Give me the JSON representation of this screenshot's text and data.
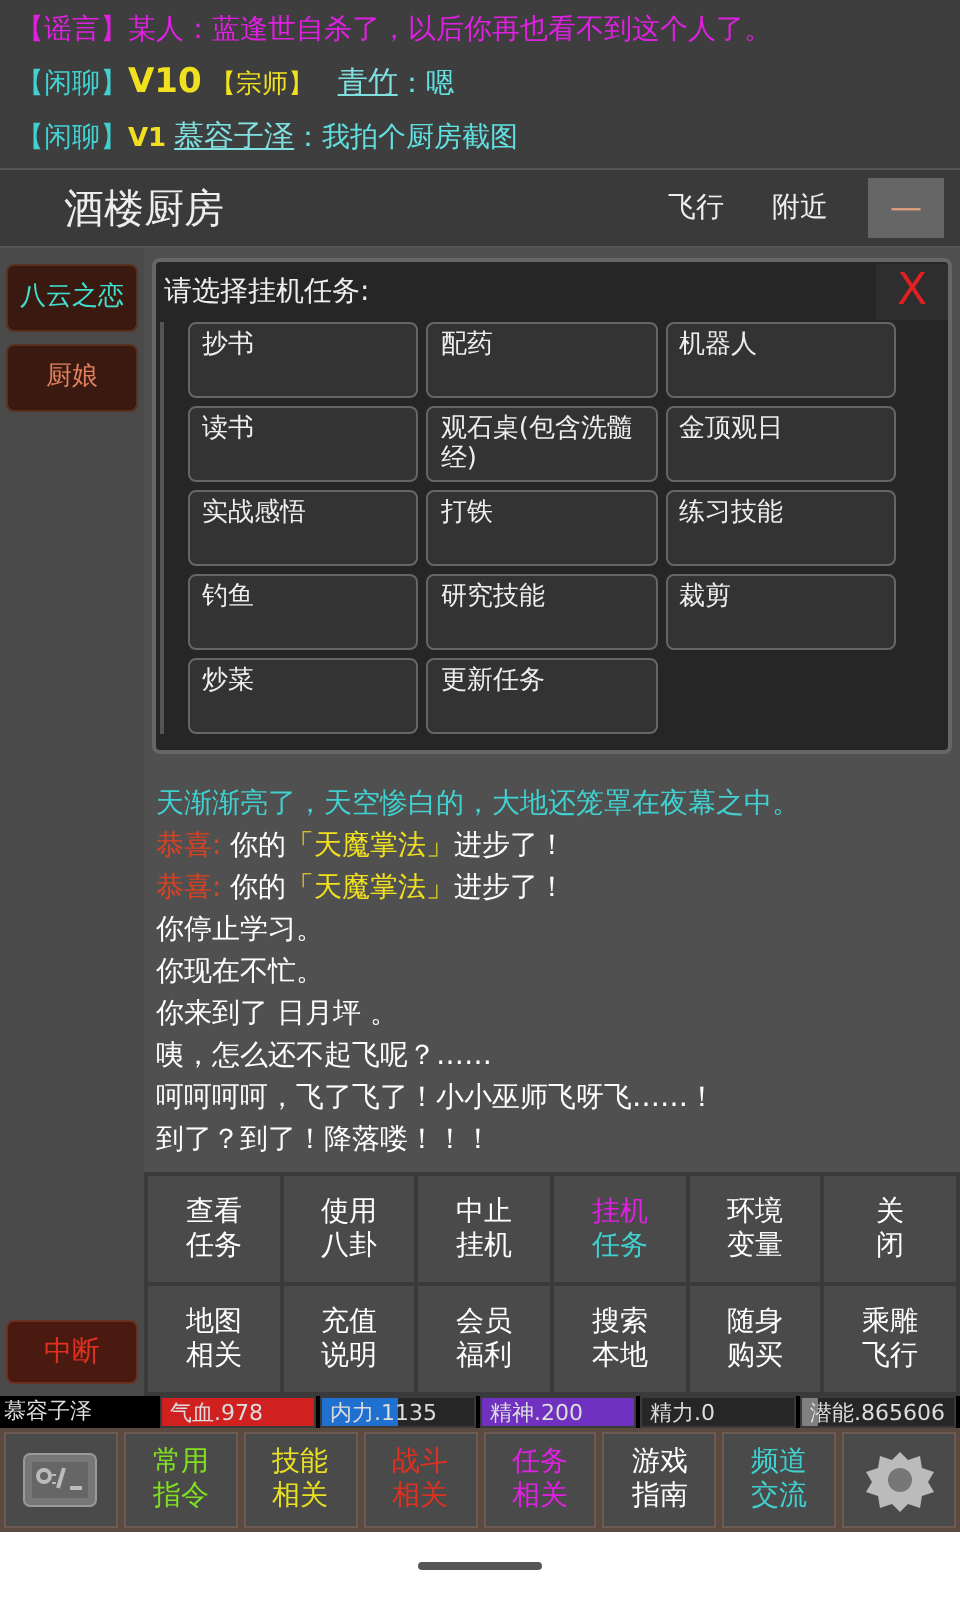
{
  "chat": [
    {
      "kind": "rumor",
      "channel": "【谣言】",
      "name": "某人",
      "name_link": false,
      "text": "：蓝逢世自杀了，以后你再也看不到这个人了。"
    },
    {
      "kind": "chat",
      "channel": "【闲聊】",
      "level_tag": "V10",
      "rank": "【宗师】",
      "name": "青竹",
      "name_link": true,
      "text": "：嗯"
    },
    {
      "kind": "chat",
      "channel": "【闲聊】",
      "level_tag": "V1",
      "name": "慕容子泽",
      "name_link": true,
      "text": "：我拍个厨房截图"
    }
  ],
  "location": {
    "title": "酒楼厨房",
    "actions": [
      "飞行",
      "附近"
    ],
    "menu": "—"
  },
  "side_buttons": [
    {
      "label": "八云之恋",
      "color": "#40e0d0"
    },
    {
      "label": "厨娘",
      "color": "#e08060"
    }
  ],
  "dialog": {
    "title": "请选择挂机任务:",
    "close": "X",
    "options": [
      "抄书",
      "配药",
      "机器人",
      "读书",
      "观石桌(包含洗髓经)",
      "金顶观日",
      "实战感悟",
      "打铁",
      "练习技能",
      "钓鱼",
      "研究技能",
      "裁剪",
      "炒菜",
      "更新任务"
    ]
  },
  "log": [
    {
      "parts": [
        {
          "text": "天渐渐亮了，天空惨白的，大地还笼罩在夜幕之中。",
          "color": "#40d0d0"
        }
      ]
    },
    {
      "parts": [
        {
          "text": "恭喜:",
          "color": "#e04020"
        },
        {
          "text": " 你的",
          "color": "#ffffff"
        },
        {
          "text": "「天魔掌法」",
          "color": "#f0e020"
        },
        {
          "text": "进步了！",
          "color": "#ffffff"
        }
      ]
    },
    {
      "parts": [
        {
          "text": "恭喜:",
          "color": "#e04020"
        },
        {
          "text": " 你的",
          "color": "#ffffff"
        },
        {
          "text": "「天魔掌法」",
          "color": "#f0e020"
        },
        {
          "text": "进步了！",
          "color": "#ffffff"
        }
      ]
    },
    {
      "parts": [
        {
          "text": "你停止学习。",
          "color": "#ffffff"
        }
      ]
    },
    {
      "parts": [
        {
          "text": "你现在不忙。",
          "color": "#ffffff"
        }
      ]
    },
    {
      "parts": [
        {
          "text": "你来到了 日月坪 。",
          "color": "#ffffff"
        }
      ]
    },
    {
      "parts": [
        {
          "text": "咦，怎么还不起飞呢？……",
          "color": "#ffffff"
        }
      ]
    },
    {
      "parts": [
        {
          "text": "呵呵呵呵，飞了飞了！小小巫师飞呀飞……！",
          "color": "#ffffff"
        }
      ]
    },
    {
      "parts": [
        {
          "text": "到了？到了！降落喽！！！",
          "color": "#ffffff"
        }
      ]
    }
  ],
  "commands": [
    {
      "lines": [
        "查看",
        "任务"
      ],
      "selected": false
    },
    {
      "lines": [
        "使用",
        "八卦"
      ],
      "selected": false
    },
    {
      "lines": [
        "中止",
        "挂机"
      ],
      "selected": false
    },
    {
      "lines": [
        "挂机",
        "任务"
      ],
      "selected": true
    },
    {
      "lines": [
        "环境",
        "变量"
      ],
      "selected": false
    },
    {
      "lines": [
        "关",
        "闭"
      ],
      "selected": false
    },
    {
      "lines": [
        "地图",
        "相关"
      ],
      "selected": false
    },
    {
      "lines": [
        "充值",
        "说明"
      ],
      "selected": false
    },
    {
      "lines": [
        "会员",
        "福利"
      ],
      "selected": false
    },
    {
      "lines": [
        "搜索",
        "本地"
      ],
      "selected": false
    },
    {
      "lines": [
        "随身",
        "购买"
      ],
      "selected": false
    },
    {
      "lines": [
        "乘雕",
        "飞行"
      ],
      "selected": false
    }
  ],
  "interrupt": "中断",
  "stats": {
    "player": "慕容子泽",
    "bars": [
      {
        "label": "气血.978",
        "color": "#d02020",
        "level": 1
      },
      {
        "label": "内力.1135",
        "color": "#2070d0",
        "level": 0.5
      },
      {
        "label": "精神.200",
        "color": "#7030c0",
        "level": 1
      },
      {
        "label": "精力.0",
        "level": 0
      },
      {
        "label": "潜能.865606",
        "color": "#808080",
        "level": 0.1
      }
    ]
  },
  "toolbar": [
    {
      "kind": "terminal"
    },
    {
      "kind": "text",
      "lines": [
        "常用",
        "指令"
      ],
      "color": "#80e020"
    },
    {
      "kind": "text",
      "lines": [
        "技能",
        "相关"
      ],
      "color": "#e8e020"
    },
    {
      "kind": "text",
      "lines": [
        "战斗",
        "相关"
      ],
      "color": "#e03020"
    },
    {
      "kind": "text",
      "lines": [
        "任务",
        "相关"
      ],
      "color": "#e020e0"
    },
    {
      "kind": "text",
      "lines": [
        "游戏",
        "指南"
      ],
      "color": "#ffffff"
    },
    {
      "kind": "text",
      "lines": [
        "频道",
        "交流"
      ],
      "color": "#40d0d0"
    },
    {
      "kind": "gear"
    }
  ]
}
